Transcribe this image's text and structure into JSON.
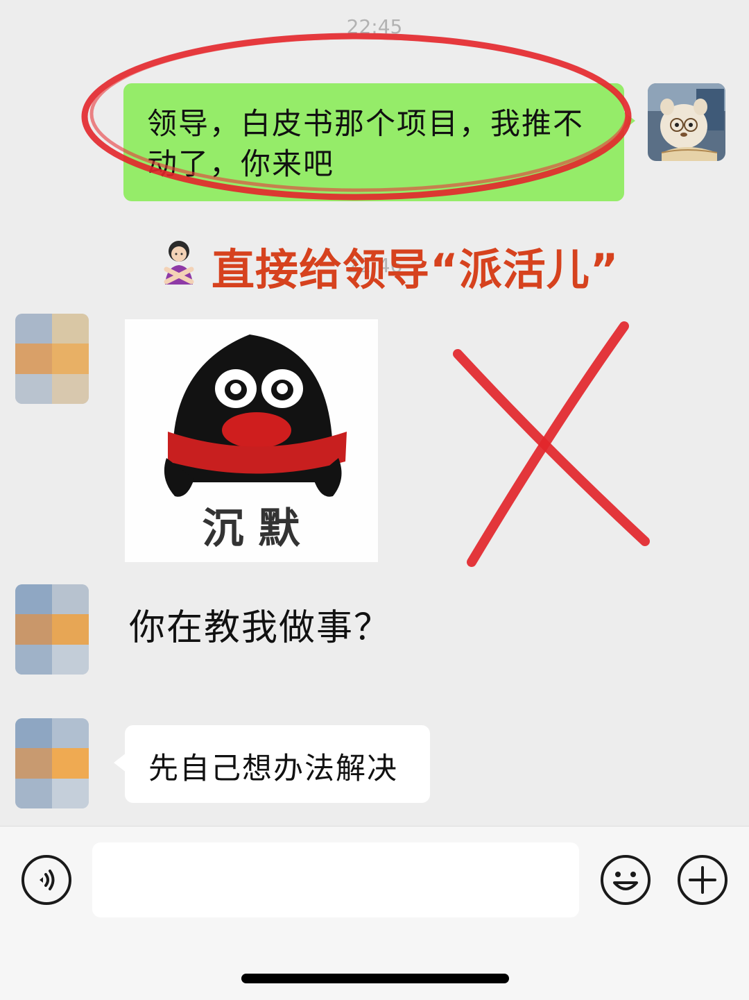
{
  "chat": {
    "timestamp_top": "22:45",
    "timestamp_middle": "22:46",
    "self_message": "领导，白皮书那个项目，我推不动了，你来吧",
    "caption": {
      "emoji": "no-gesture-woman-emoji",
      "text": "直接给领导“派活儿”"
    },
    "sticker": {
      "label": "沉 默"
    },
    "reply_plain": "你在教我做事？",
    "reply_bubble": "先自己想办法解决"
  },
  "input_bar": {
    "voice_icon": "voice-icon",
    "emoji_icon": "smiley-icon",
    "plus_icon": "plus-icon",
    "text_value": ""
  },
  "colors": {
    "background": "#ededed",
    "self_bubble": "#95ec69",
    "other_bubble": "#ffffff",
    "annotation_red": "#e2262b",
    "caption_red": "#d6421e"
  }
}
